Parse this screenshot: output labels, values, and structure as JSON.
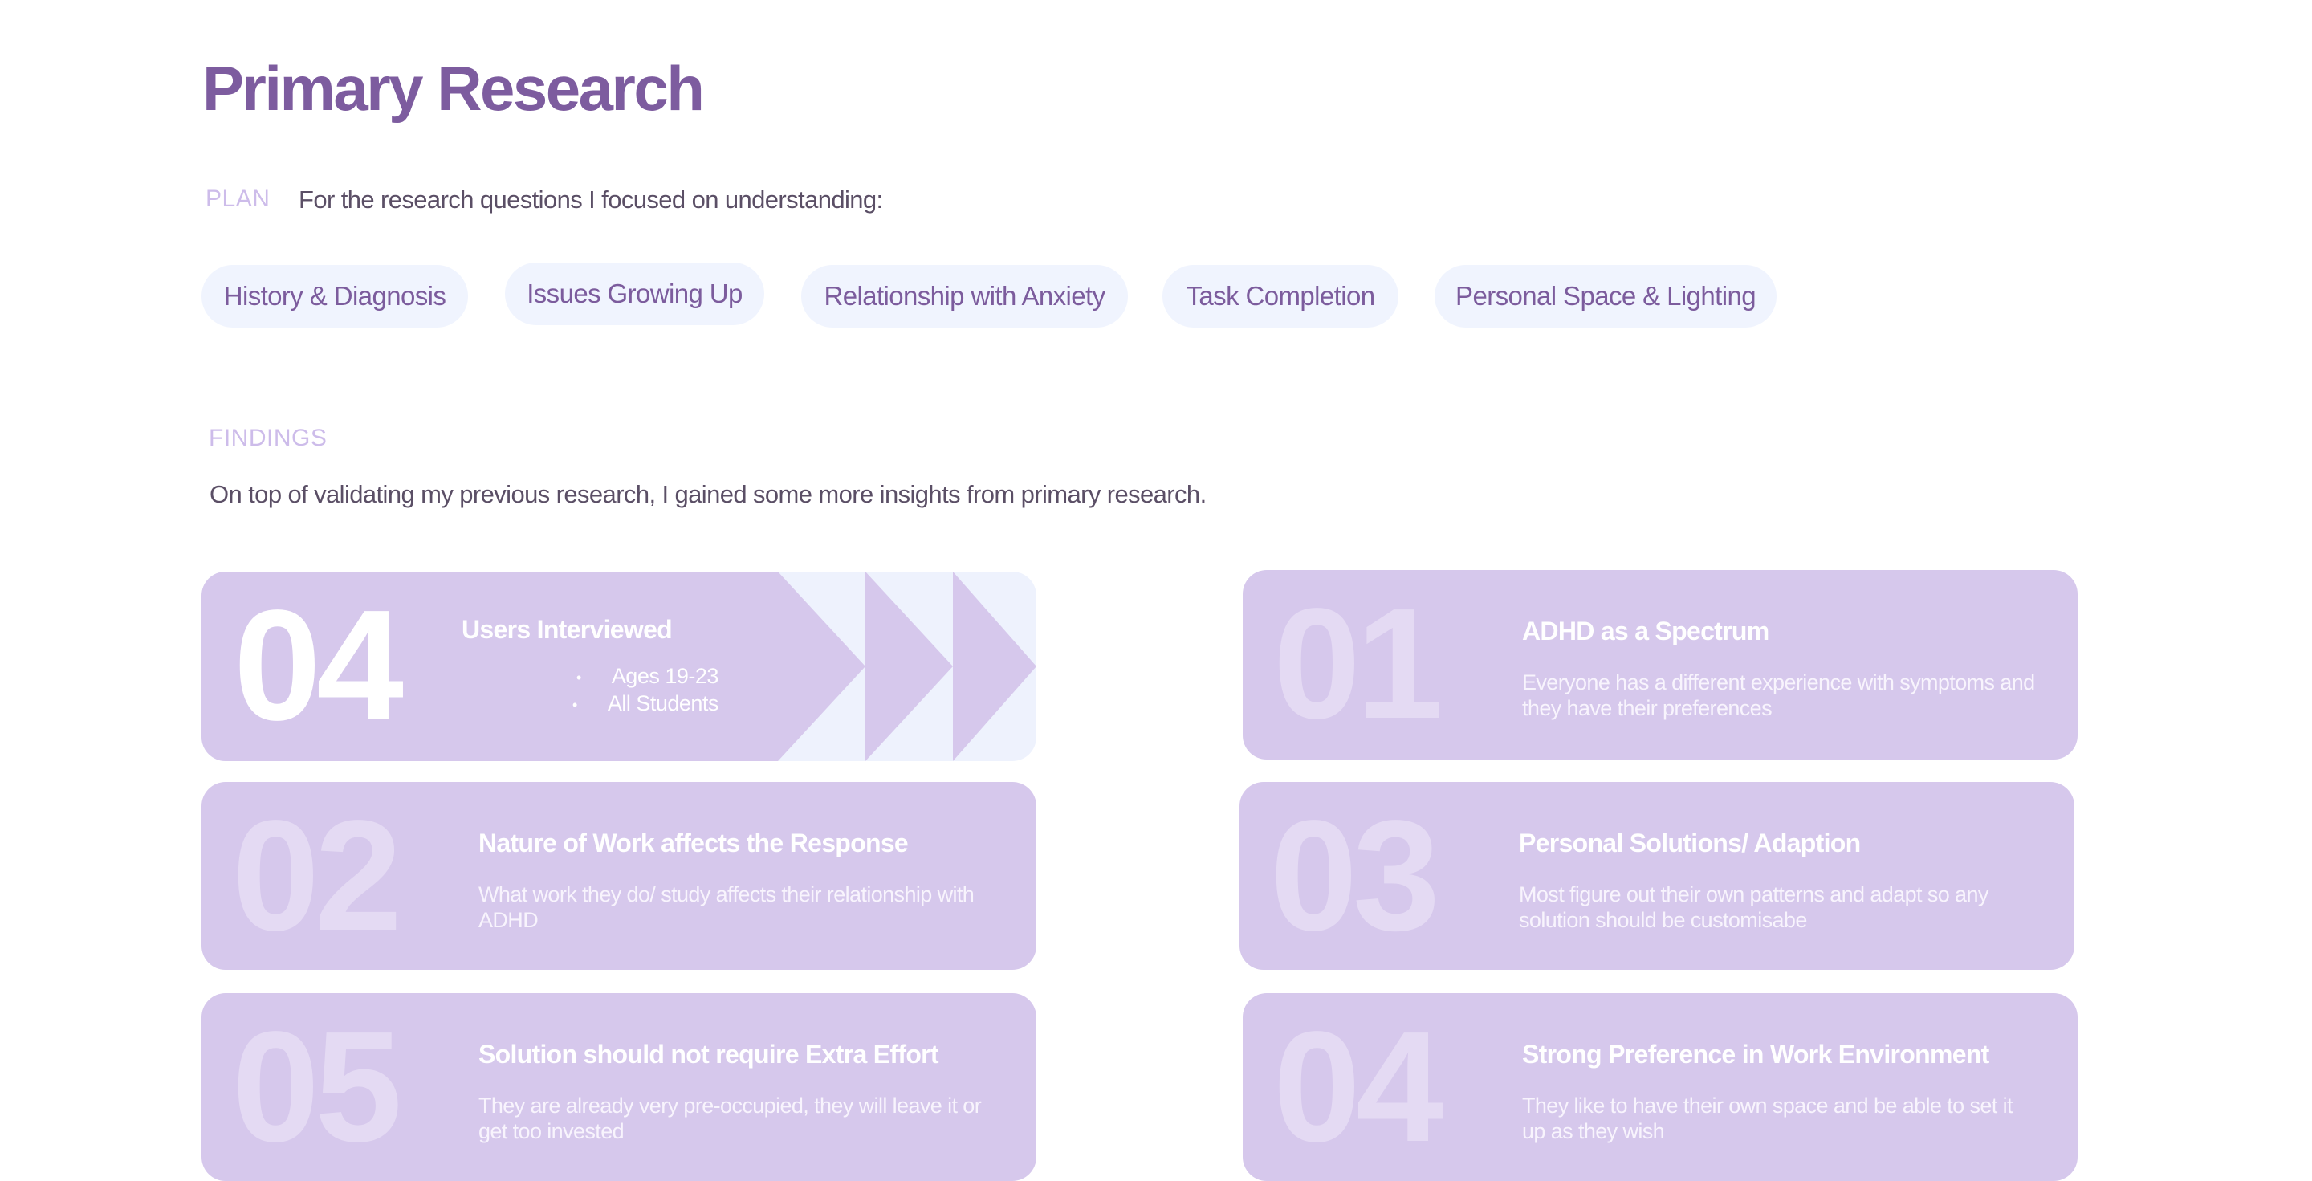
{
  "title": "Primary Research",
  "plan": {
    "label": "PLAN",
    "intro": "For the research questions I focused on understanding:",
    "topics": [
      "History & Diagnosis",
      "Issues Growing Up",
      "Relationship with Anxiety",
      "Task Completion",
      "Personal Space & Lighting"
    ]
  },
  "findings": {
    "label": "FINDINGS",
    "intro": "On top of validating my previous research, I gained some more insights from primary research.",
    "users": {
      "number": "04",
      "title": "Users Interviewed",
      "bullets": [
        "Ages 19-23",
        "All Students"
      ]
    },
    "cards": [
      {
        "number": "01",
        "title": "ADHD as a Spectrum",
        "description": "Everyone has a different experience with symptoms and they have their preferences"
      },
      {
        "number": "02",
        "title": "Nature of Work affects the Response",
        "description": "What work they do/ study affects their relationship with ADHD"
      },
      {
        "number": "03",
        "title": "Personal Solutions/ Adaption",
        "description": "Most figure out their own patterns and adapt so any solution should be customisabe"
      },
      {
        "number": "05",
        "title": "Solution should not require Extra Effort",
        "description": "They are already very pre-occupied, they will leave it or get too invested"
      },
      {
        "number": "04",
        "title": "Strong Preference in Work Environment",
        "description": "They like to have their own space and be able to set it up as they wish"
      }
    ]
  },
  "colors": {
    "title": "#7d5c9f",
    "card": "#d6c8ec",
    "chip": "#f0f4fe",
    "label": "#cdbcea"
  }
}
